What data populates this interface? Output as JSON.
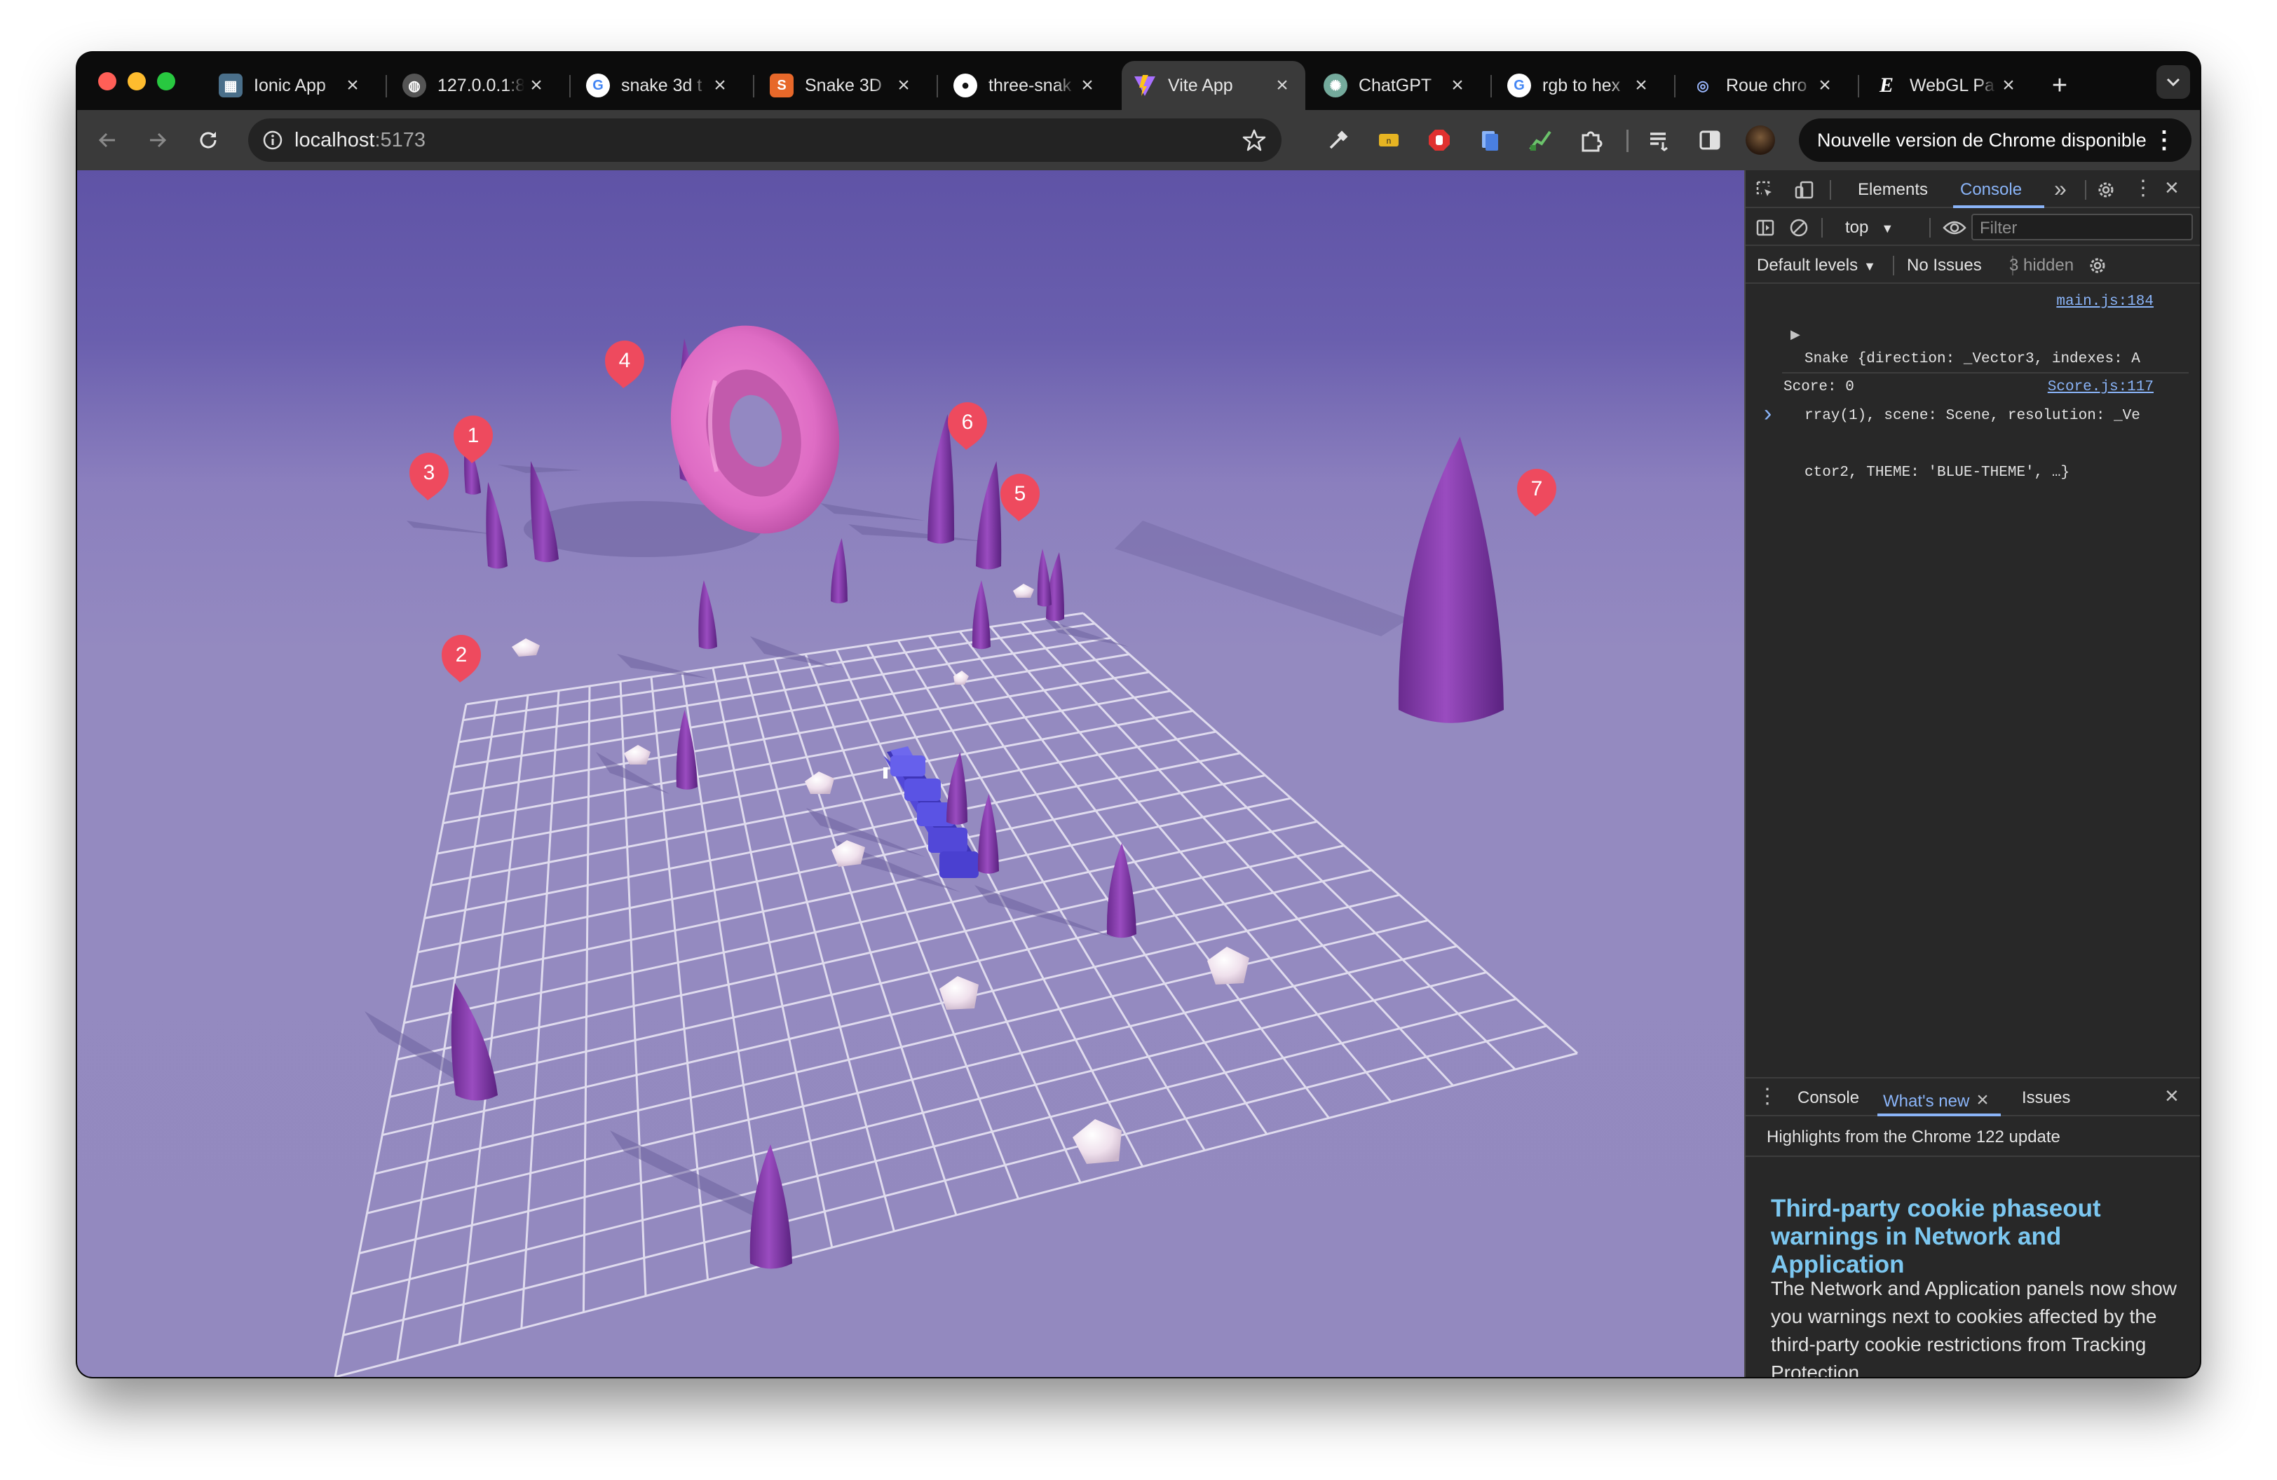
{
  "browser": {
    "tabs": [
      {
        "label": "Ionic App",
        "icon": "ionic-favicon"
      },
      {
        "label": "127.0.0.1:8",
        "icon": "globe-icon"
      },
      {
        "label": "snake 3d t",
        "icon": "google-icon"
      },
      {
        "label": "Snake 3D",
        "icon": "snake3d-favicon"
      },
      {
        "label": "three-snak",
        "icon": "github-icon"
      },
      {
        "label": "Vite App",
        "icon": "vite-icon",
        "active": true
      },
      {
        "label": "ChatGPT",
        "icon": "chatgpt-icon"
      },
      {
        "label": "rgb to hex",
        "icon": "google-icon"
      },
      {
        "label": "Roue chro",
        "icon": "color-wheel-icon"
      },
      {
        "label": "WebGL Pa",
        "icon": "webgl-e-icon"
      }
    ],
    "new_tab": "+",
    "address": {
      "host": "localhost",
      "port": ":5173"
    },
    "update_banner": "Nouvelle version de Chrome disponible"
  },
  "scene": {
    "markers": [
      "1",
      "2",
      "3",
      "4",
      "5",
      "6",
      "7"
    ],
    "colors": {
      "sky_top": "#5f53a6",
      "ground": "#9389bf",
      "spike": "#8a3fb0",
      "donut": "#e070c8",
      "snake": "#5a4fe0",
      "marker": "#ee4a5e",
      "rock": "#f1e6ef"
    }
  },
  "devtools": {
    "tabs": [
      "Elements",
      "Console"
    ],
    "active_tab": "Console",
    "context": "top",
    "filter_placeholder": "Filter",
    "levels": "Default levels",
    "issues": "No Issues",
    "hidden": "3 hidden",
    "console": {
      "log1_source": "main.js:184",
      "log1_line1": "Snake {direction: _Vector3, indexes: A",
      "log1_line2": "rray(1), scene: Scene, resolution: _Ve",
      "log1_line3": "ctor2, THEME: 'BLUE-THEME', …}",
      "log2_text": "Score: 0",
      "log2_source": "Score.js:117",
      "prompt": "›"
    },
    "drawer": {
      "tabs": [
        "Console",
        "What's new",
        "Issues"
      ],
      "active_tab": "What's new",
      "subtitle": "Highlights from the Chrome 122 update",
      "title": "Third-party cookie phaseout warnings in Network and Application",
      "body": "The Network and Application panels now show you warnings next to cookies affected by the third-party cookie restrictions from Tracking Protection."
    }
  }
}
